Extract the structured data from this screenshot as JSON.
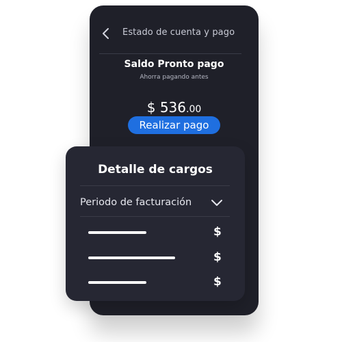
{
  "header": {
    "back_icon": "chevron-left-icon",
    "title": "Estado de cuenta y pago"
  },
  "balance": {
    "title": "Saldo Pronto pago",
    "subtitle": "Ahorra pagando antes",
    "amount_main": "$ 536",
    "amount_cents": ".00",
    "pay_button_label": "Realizar pago"
  },
  "charges": {
    "title": "Detalle de cargos",
    "period_label": "Periodo de facturación",
    "period_icon": "chevron-down-icon",
    "rows": [
      {
        "currency": "$"
      },
      {
        "currency": "$"
      },
      {
        "currency": "$"
      }
    ]
  },
  "colors": {
    "panel_background": "#1f2029",
    "card_background": "#262733",
    "accent": "#1f6fe0",
    "text_primary": "#ffffff"
  }
}
